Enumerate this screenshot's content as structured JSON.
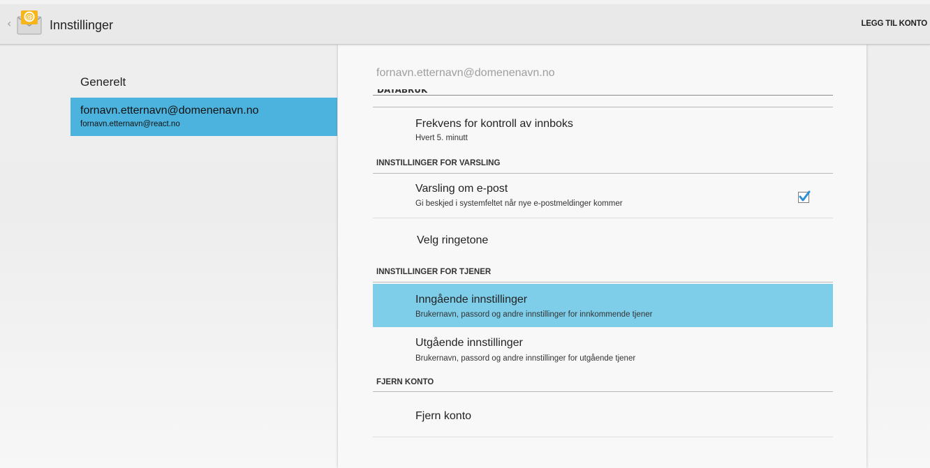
{
  "actionbar": {
    "title": "Innstillinger",
    "app_icon": "email-app-icon",
    "add_account_label": "LEGG TIL KONTO"
  },
  "left_pane": {
    "general_label": "Generelt",
    "account": {
      "title": "fornavn.etternavn@domenenavn.no",
      "subtitle": "fornavn.etternavn@react.no",
      "selected": true
    }
  },
  "right_pane": {
    "title": "fornavn.etternavn@domenenavn.no",
    "partial_header": "DATABRUK",
    "items": {
      "inbox_frequency": {
        "title": "Frekvens for kontroll av innboks",
        "summary": "Hvert 5. minutt"
      },
      "email_notify": {
        "title": "Varsling om e-post",
        "summary": "Gi beskjed i systemfeltet når nye e-postmeldinger kommer",
        "checked": true
      },
      "ringtone": {
        "title": "Velg ringetone"
      },
      "incoming": {
        "title": "Inngående innstillinger",
        "summary": "Brukernavn, passord og andre innstillinger for innkommende tjener",
        "highlighted": true
      },
      "outgoing": {
        "title": "Utgående innstillinger",
        "summary": "Brukernavn, passord og andre innstillinger for utgående tjener"
      },
      "remove_account": {
        "title": "Fjern konto"
      }
    },
    "sections": {
      "notifications": "INNSTILLINGER FOR VARSLING",
      "server": "INNSTILLINGER FOR TJENER",
      "remove": "FJERN KONTO"
    }
  },
  "colors": {
    "selected_blue": "#4bb3dd",
    "highlight_blue": "#7ecde9",
    "check_blue": "#2a8fd6"
  }
}
